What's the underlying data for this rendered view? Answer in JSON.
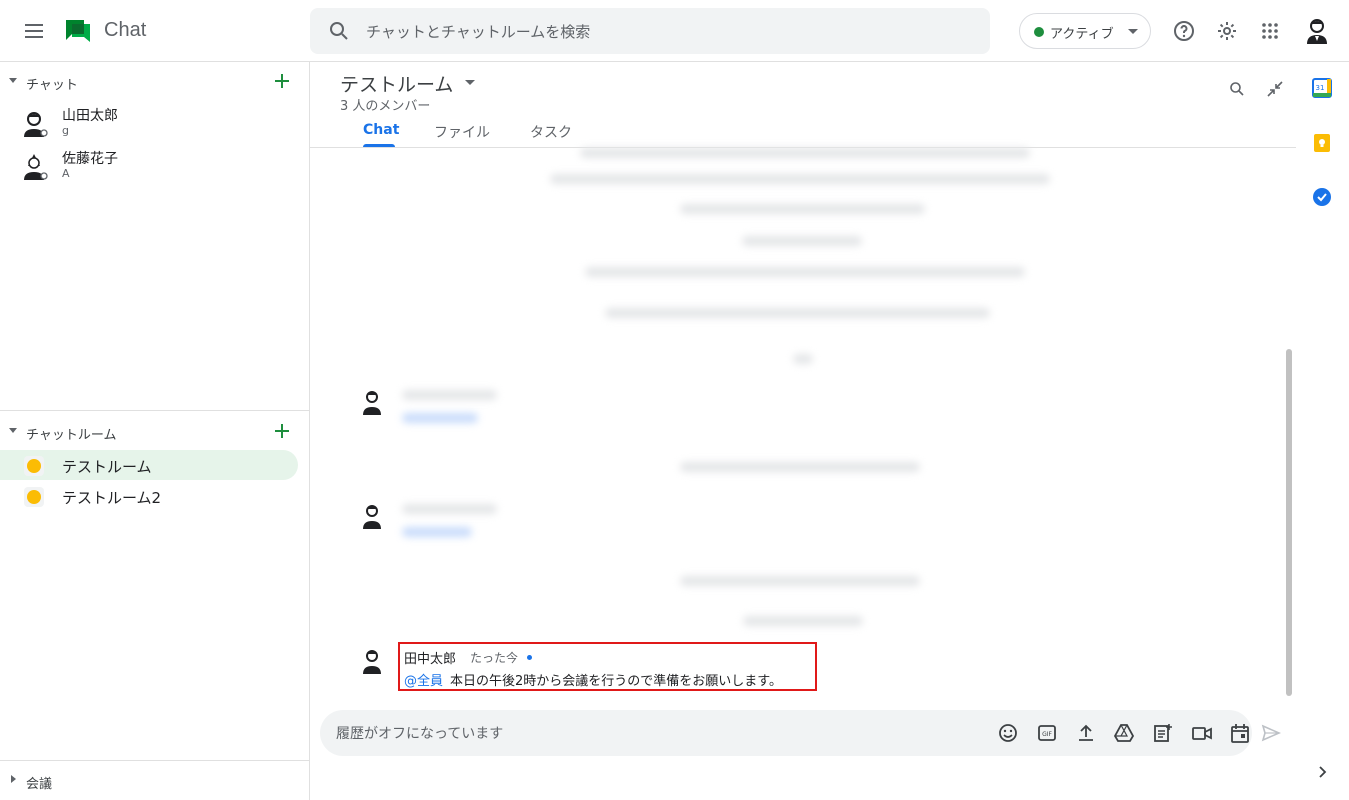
{
  "header": {
    "app_title": "Chat",
    "search_placeholder": "チャットとチャットルームを検索",
    "status_label": "アクティブ",
    "icons": [
      "menu-icon",
      "help-icon",
      "settings-icon",
      "apps-grid-icon",
      "account-avatar"
    ]
  },
  "sidebar": {
    "chat_section_label": "チャット",
    "direct_messages": [
      {
        "name": "山田太郎",
        "sub": "g"
      },
      {
        "name": "佐藤花子",
        "sub": "A"
      }
    ],
    "rooms_section_label": "チャットルーム",
    "rooms": [
      {
        "name": "テストルーム",
        "active": true
      },
      {
        "name": "テストルーム2",
        "active": false
      }
    ],
    "meetings_label": "会議"
  },
  "room": {
    "title": "テストルーム",
    "members": "3 人のメンバー",
    "tabs": [
      "Chat",
      "ファイル",
      "タスク"
    ],
    "active_tab": "Chat"
  },
  "latest_message": {
    "sender": "田中太郎",
    "time": "たった今",
    "mention": "@全員",
    "text": "本日の午後2時から会議を行うので準備をお願いします。"
  },
  "composer": {
    "placeholder": "履歴がオフになっています",
    "icons": [
      "emoji-icon",
      "gif-icon",
      "upload-icon",
      "drive-icon",
      "create-task-icon",
      "video-meeting-icon",
      "calendar-invite-icon",
      "send-icon"
    ]
  },
  "colors": {
    "accent": "#1a73e8",
    "active_status": "#1e8e3e",
    "active_room_bg": "#e6f4ea",
    "highlight_box": "#e01919"
  }
}
